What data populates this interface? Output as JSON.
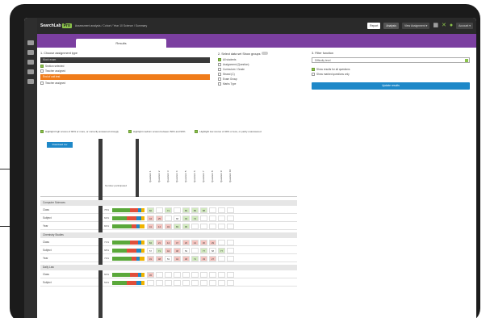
{
  "app": {
    "brand": "SearchLab",
    "brand_badge": "Pro",
    "breadcrumb": "Assessment analysis / Cohort / Year 10 Science / Summary"
  },
  "topbar": {
    "buttons": [
      "Report",
      "Analysis",
      "View Assignment ▾"
    ],
    "menu_label": "Account ▾"
  },
  "tab": {
    "label": "Results"
  },
  "assignment_panel": {
    "title": "1. Choose assignment type",
    "selected_primary": "Mock exam",
    "option_1": "Section selected",
    "option_2": "Teacher assigned",
    "selected_secondary": "End of unit test",
    "option_3": "Teacher assigned"
  },
  "data_panel": {
    "title": "2. Select data set",
    "toggle_label": "Show groups",
    "items": [
      "All students",
      "Assignment (Question)",
      "Curriculum / Grade",
      "Strand (C)",
      "Exam Group",
      "Marks Type"
    ]
  },
  "filter_panel": {
    "title": "3. Filter function",
    "input_value": "Difficulty level",
    "opt_1": "Show results for all questions",
    "opt_2": "Show marked questions only",
    "button": "Update results"
  },
  "highlights": [
    "Highlight high scores of 90% or more, or correctly answered strongly",
    "Highlight medium scores between 50% and 90%",
    "Highlight low scores of 49% or less, or partly unanswered"
  ],
  "grid": {
    "header_button": "Download csv",
    "header_total_label": "Number participated",
    "columns": [
      "Question 1",
      "Question 2",
      "Question 3",
      "Question 4",
      "Question 5",
      "Question 6",
      "Question 7",
      "Question 8",
      "Question 9",
      "Question 10"
    ],
    "sections": [
      {
        "title": "Computer Sciences",
        "rows": [
          {
            "name": "Class",
            "count": "75%",
            "num": "31",
            "cells": [
              "82",
              "",
              "71",
              "",
              "86",
              "85",
              "88",
              "",
              "",
              ""
            ]
          },
          {
            "name": "Subject",
            "count": "62%",
            "num": "21",
            "cells": [
              "44",
              "25",
              "",
              "68",
              "93",
              "74",
              "",
              "",
              "",
              ""
            ]
          },
          {
            "name": "Year",
            "count": "84%",
            "num": "57",
            "cells": [
              "41",
              "14",
              "43",
              "83",
              "95",
              "",
              "",
              "",
              "",
              ""
            ]
          }
        ]
      },
      {
        "title": "Chemistry Studies",
        "rows": [
          {
            "name": "Class",
            "count": "71%",
            "num": "33",
            "cells": [
              "84",
              "21",
              "14",
              "47",
              "20",
              "14",
              "30",
              "29",
              "",
              ""
            ]
          },
          {
            "name": "Subject",
            "count": "68%",
            "num": "41",
            "cells": [
              "57",
              "71",
              "44",
              "48",
              "59",
              "",
              "77",
              "58",
              "77",
              ""
            ]
          },
          {
            "name": "Year",
            "count": "73%",
            "num": "52",
            "cells": [
              "31",
              "48",
              "53",
              "44",
              "48",
              "71",
              "33",
              "27",
              "",
              ""
            ]
          }
        ]
      },
      {
        "title": "Daily Law",
        "rows": [
          {
            "name": "Class",
            "count": "60%",
            "num": "12",
            "cells": [
              "45",
              "",
              "",
              "",
              "",
              "",
              "",
              "",
              "",
              ""
            ]
          },
          {
            "name": "Subject",
            "count": "53%",
            "num": "18",
            "cells": [
              "",
              "",
              "",
              "",
              "",
              "",
              "",
              "",
              "",
              ""
            ]
          }
        ]
      }
    ]
  }
}
